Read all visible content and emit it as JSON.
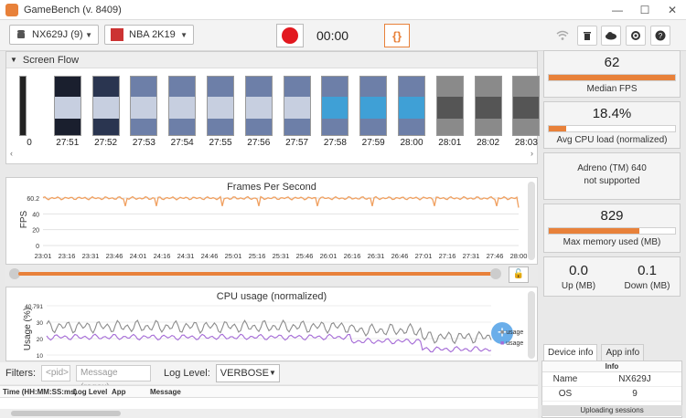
{
  "window": {
    "title": "GameBench (v. 8409)",
    "min": "—",
    "max": "☐",
    "close": "✕"
  },
  "toolbar": {
    "device": "NX629J (9)",
    "app": "NBA 2K19",
    "timer": "00:00",
    "brace": "{}",
    "icons": [
      "wifi-icon",
      "trash-icon",
      "cloud-upload-icon",
      "settings-icon",
      "help-icon"
    ]
  },
  "screen_flow": {
    "title": "Screen Flow",
    "timestamps": [
      "0",
      "27:51",
      "27:52",
      "27:53",
      "27:54",
      "27:55",
      "27:56",
      "27:57",
      "27:58",
      "27:59",
      "28:00",
      "28:01",
      "28:02",
      "28:03"
    ]
  },
  "fps_chart": {
    "title": "Frames Per Second",
    "ylabel": "FPS",
    "yticks": [
      "60.2",
      "40",
      "20",
      "0"
    ],
    "xticks": [
      "23:01",
      "23:16",
      "23:31",
      "23:46",
      "24:01",
      "24:16",
      "24:31",
      "24:46",
      "25:01",
      "25:16",
      "25:31",
      "25:46",
      "26:01",
      "26:16",
      "26:31",
      "26:46",
      "27:01",
      "27:16",
      "27:31",
      "27:46",
      "28:00"
    ],
    "color": "#f0a060"
  },
  "cpu_chart": {
    "title": "CPU usage (normalized)",
    "ylabel": "Usage (%)",
    "yticks": [
      "40.791",
      "30",
      "20",
      "10"
    ],
    "legend": [
      "usage",
      "usage"
    ],
    "colors": [
      "#8c8c8c",
      "#a46ad6"
    ]
  },
  "filters": {
    "label": "Filters:",
    "pid_placeholder": "<pid>",
    "message_placeholder": "Message (regex)",
    "log_level_label": "Log Level:",
    "log_level_value": "VERBOSE"
  },
  "log_columns": [
    "Time (HH:MM:SS:ms)",
    "Log Level",
    "App",
    "Message"
  ],
  "stats": {
    "median_fps": {
      "value": "62",
      "label": "Median FPS",
      "fill": 1.0
    },
    "avg_cpu": {
      "value": "18.4%",
      "label": "Avg CPU load (normalized)",
      "fill": 0.14
    },
    "gpu": {
      "line1": "Adreno (TM) 640",
      "line2": "not supported"
    },
    "max_memory": {
      "value": "829",
      "label": "Max memory used (MB)",
      "fill": 0.72
    },
    "up": {
      "value": "0.0",
      "label": "Up (MB)"
    },
    "down": {
      "value": "0.1",
      "label": "Down (MB)"
    }
  },
  "tabs": [
    "Device info",
    "App info"
  ],
  "device_info": {
    "header": "Info",
    "rows": [
      {
        "key": "Name",
        "value": "NX629J"
      },
      {
        "key": "OS",
        "value": "9"
      }
    ]
  },
  "status": "Uploading sessions"
}
